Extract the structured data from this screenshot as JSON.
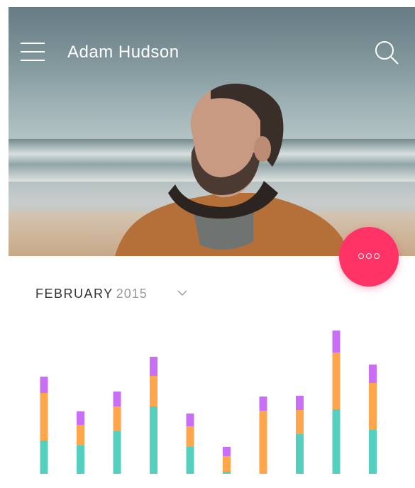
{
  "header": {
    "title": "Adam Hudson",
    "menu_icon": "hamburger-menu-icon",
    "search_icon": "search-icon"
  },
  "fab": {
    "icon": "more-dots-icon",
    "color": "#ff3366"
  },
  "period": {
    "month": "FEBRUARY",
    "year": "2015",
    "dropdown_icon": "chevron-down-icon"
  },
  "colors": {
    "teal": "#55d0bf",
    "orange": "#ffa64d",
    "purple": "#c86ff5",
    "accent": "#ff3366"
  },
  "chart_data": {
    "type": "bar",
    "stacked": true,
    "categories": [
      "",
      "",
      "",
      "",
      "",
      "",
      "",
      "",
      "",
      ""
    ],
    "series": [
      {
        "color": "#55d0bf",
        "values": [
          47,
          40,
          60,
          95,
          38,
          3,
          0,
          56,
          91,
          62
        ]
      },
      {
        "color": "#ffa64d",
        "values": [
          67,
          29,
          35,
          43,
          29,
          22,
          89,
          34,
          80,
          66
        ]
      },
      {
        "color": "#c86ff5",
        "values": [
          23,
          19,
          21,
          27,
          18,
          13,
          20,
          20,
          31,
          26
        ]
      }
    ],
    "ylim": [
      0,
      202
    ],
    "grid": false,
    "legend": "none"
  }
}
